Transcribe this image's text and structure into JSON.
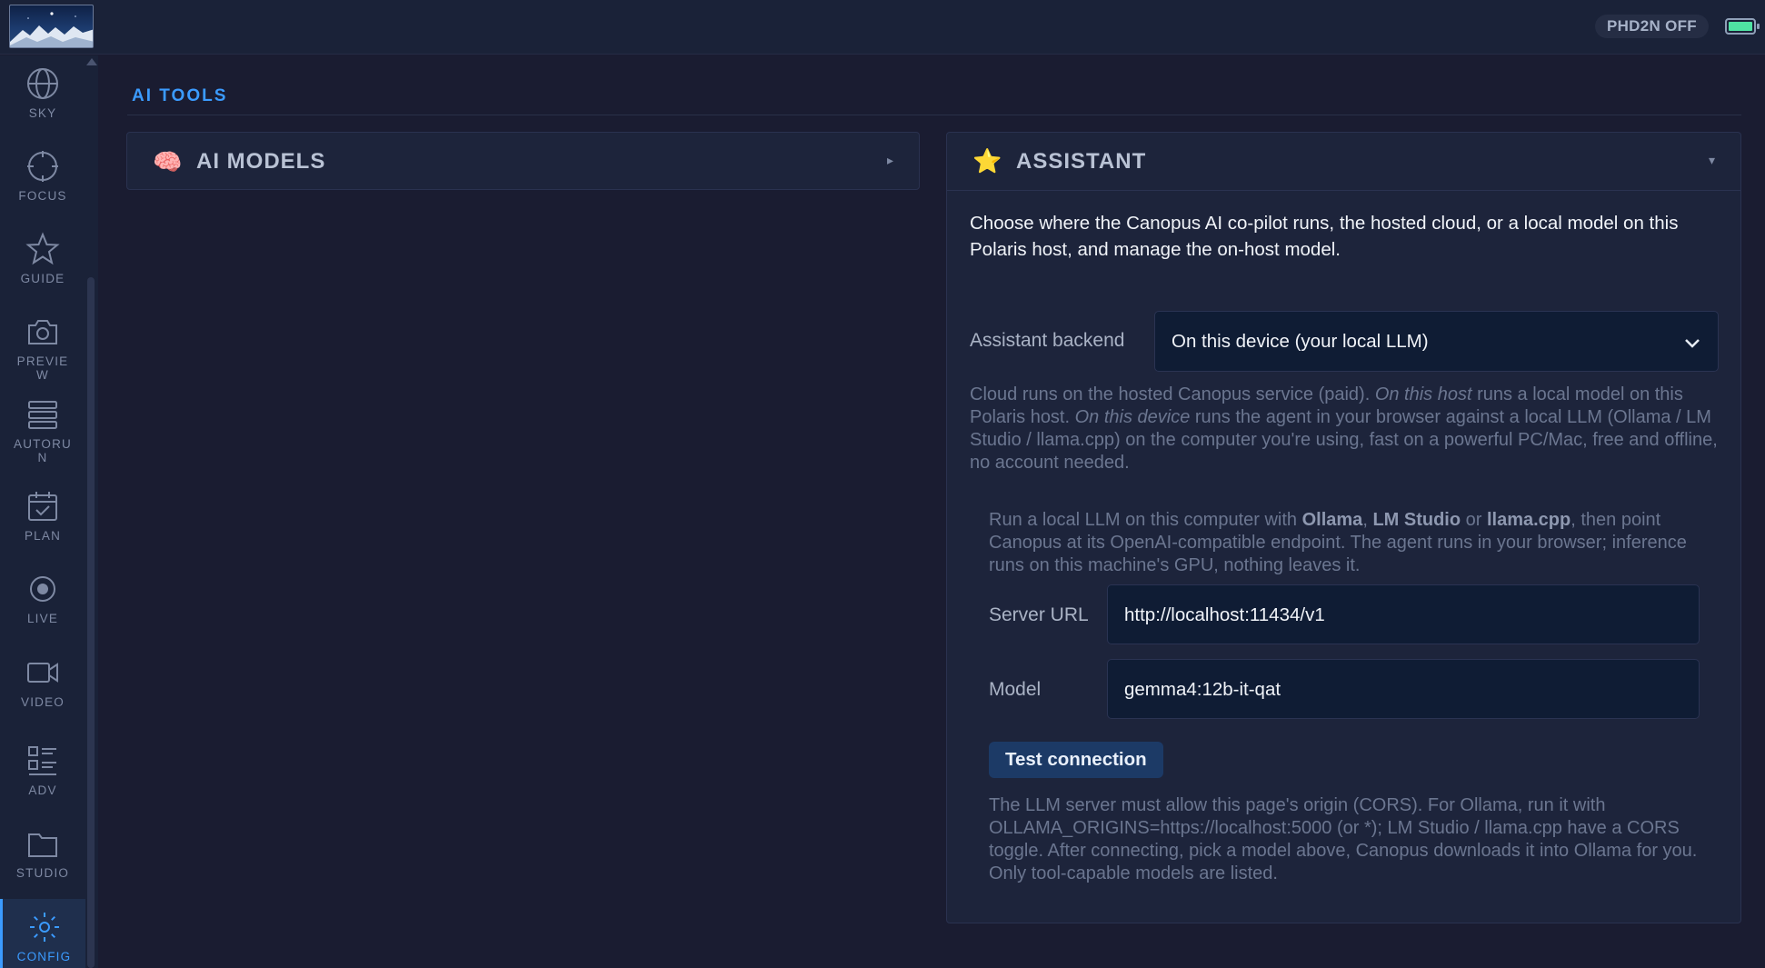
{
  "topbar": {
    "status_pill": "PHD2N OFF",
    "battery_icon": "battery-icon"
  },
  "sidebar": {
    "items": [
      {
        "label": "SKY",
        "icon": "globe-icon"
      },
      {
        "label": "FOCUS",
        "icon": "crosshair-icon"
      },
      {
        "label": "GUIDE",
        "icon": "star-icon"
      },
      {
        "label": "PREVIEW",
        "icon": "camera-icon"
      },
      {
        "label": "AUTORUN",
        "icon": "stack-icon"
      },
      {
        "label": "PLAN",
        "icon": "calendar-check-icon"
      },
      {
        "label": "LIVE",
        "icon": "target-icon"
      },
      {
        "label": "VIDEO",
        "icon": "video-icon"
      },
      {
        "label": "ADV",
        "icon": "list-icon"
      },
      {
        "label": "STUDIO",
        "icon": "folder-icon"
      },
      {
        "label": "CONFIG",
        "icon": "gear-icon",
        "active": true
      }
    ],
    "accent_color": "#3b9bff"
  },
  "main": {
    "section_title": "AI TOOLS",
    "ai_models": {
      "title": "AI MODELS",
      "icon": "🧠",
      "collapsed": true
    },
    "assistant": {
      "title": "ASSISTANT",
      "icon": "⭐",
      "description": "Choose where the Canopus AI co-pilot runs, the hosted cloud, or a local model on this Polaris host, and manage the on-host model.",
      "backend_label": "Assistant backend",
      "backend_value": "On this device (your local LLM)",
      "backend_hint": {
        "p1": "Cloud runs on the hosted Canopus service (paid). ",
        "em1": "On this host",
        "p2": " runs a local model on this Polaris host. ",
        "em2": "On this device",
        "p3": " runs the agent in your browser against a local LLM (Ollama / LM Studio / llama.cpp) on the computer you're using, fast on a powerful PC/Mac, free and offline, no account needed."
      },
      "local_hint": {
        "p1": "Run a local LLM on this computer with ",
        "b1": "Ollama",
        "sep1": ", ",
        "b2": "LM Studio",
        "sep2": " or ",
        "b3": "llama.cpp",
        "p2": ", then point Canopus at its OpenAI-compatible endpoint. The agent runs in your browser; inference runs on this machine's GPU, nothing leaves it."
      },
      "server_url_label": "Server URL",
      "server_url_value": "http://localhost:11434/v1",
      "model_label": "Model",
      "model_value": "gemma4:12b-it-qat",
      "test_button": "Test connection",
      "cors_hint": "The LLM server must allow this page's origin (CORS). For Ollama, run it with OLLAMA_ORIGINS=https://localhost:5000 (or *); LM Studio / llama.cpp have a CORS toggle. After connecting, pick a model above, Canopus downloads it into Ollama for you. Only tool-capable models are listed."
    }
  }
}
